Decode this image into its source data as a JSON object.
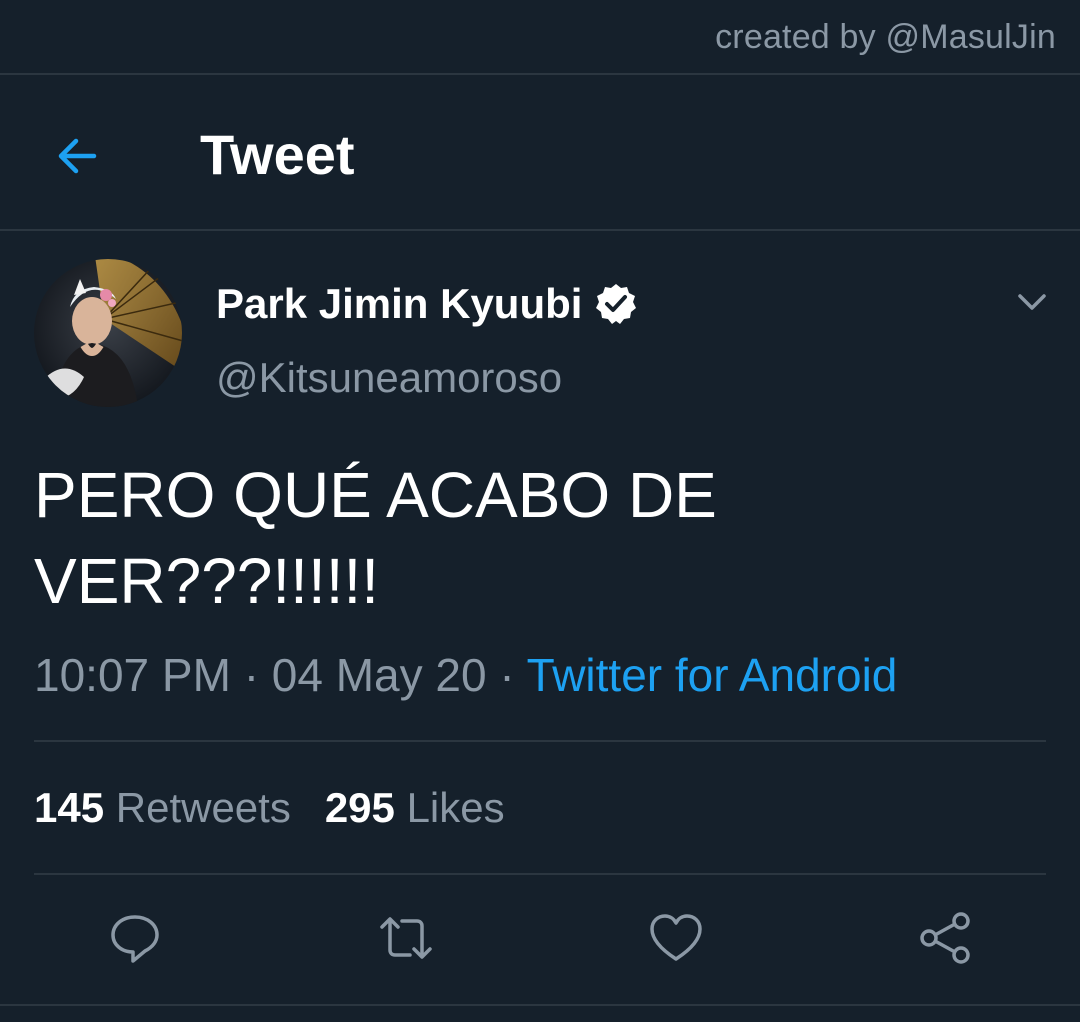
{
  "credit": "created by @MasulJin",
  "header": {
    "title": "Tweet",
    "back_icon": "arrow-left-icon"
  },
  "tweet": {
    "author_name": "Park Jimin Kyuubi",
    "handle": "@Kitsuneamoroso",
    "verified": true,
    "text_line1": "PERO QUÉ ACABO DE",
    "text_line2": "VER???!!!!!!",
    "time": "10:07 PM",
    "date": "04 May 20",
    "separator": "·",
    "source": "Twitter for Android",
    "retweets_count": "145",
    "retweets_label": "Retweets",
    "likes_count": "295",
    "likes_label": "Likes"
  },
  "actions": [
    {
      "name": "reply",
      "icon": "reply-icon"
    },
    {
      "name": "retweet",
      "icon": "retweet-icon"
    },
    {
      "name": "like",
      "icon": "heart-icon"
    },
    {
      "name": "share",
      "icon": "share-icon"
    }
  ],
  "colors": {
    "background": "#15202b",
    "accent": "#1da1f2",
    "secondary_text": "#8b98a5",
    "divider": "#2b3640"
  }
}
